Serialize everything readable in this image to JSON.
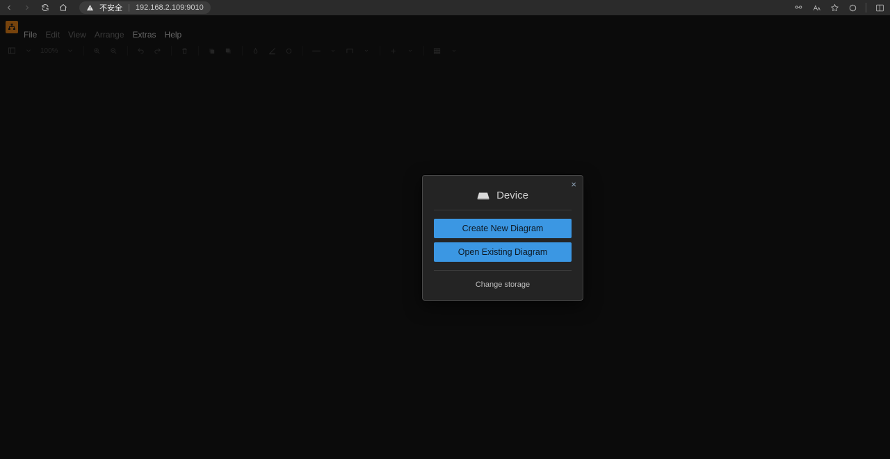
{
  "browser": {
    "security_label": "不安全",
    "url": "192.168.2.109:9010"
  },
  "menubar": {
    "file": "File",
    "edit": "Edit",
    "view": "View",
    "arrange": "Arrange",
    "extras": "Extras",
    "help": "Help"
  },
  "toolbar": {
    "zoom": "100%"
  },
  "dialog": {
    "title": "Device",
    "create_btn": "Create New Diagram",
    "open_btn": "Open Existing Diagram",
    "change_storage": "Change storage"
  }
}
